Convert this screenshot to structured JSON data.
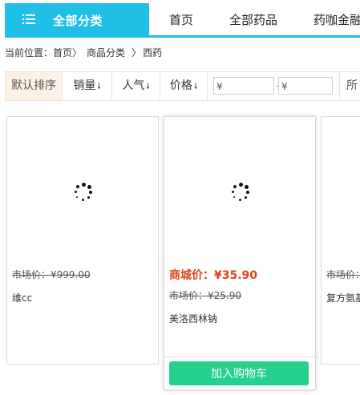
{
  "nav": {
    "all_categories": "全部分类",
    "links": [
      "首页",
      "全部药品",
      "药咖金融"
    ],
    "accent_color": "#1fbfe6"
  },
  "breadcrumb": {
    "prefix": "当前位置：",
    "items": [
      "首页",
      "商品分类",
      "西药"
    ],
    "separator": "〉"
  },
  "sortbar": {
    "default_sort": "默认排序",
    "sales": "销量",
    "popularity": "人气",
    "price": "价格",
    "arrow": "🠗",
    "price_min_placeholder": "¥",
    "price_max_placeholder": "¥",
    "range_dash": "-",
    "partial_label": "所"
  },
  "products": [
    {
      "market_price": "市场价：¥999.00",
      "name": "维cc"
    },
    {
      "mall_price": "商城价：¥35.90",
      "market_price": "市场价：¥25.90",
      "name": "美洛西林钠",
      "add_to_cart": "加入购物车"
    },
    {
      "market_price": "市场价：¥",
      "name": "复方氨基"
    }
  ],
  "colors": {
    "price": "#e0421a",
    "cart_button": "#26d08e",
    "active_sort_bg": "#fdf1e6"
  }
}
